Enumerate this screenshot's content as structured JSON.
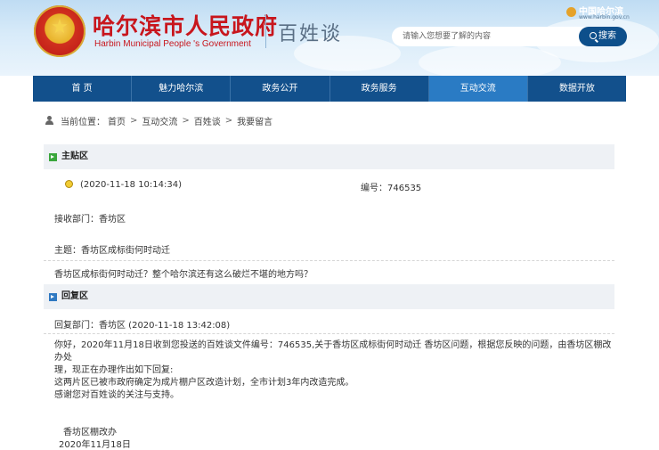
{
  "header": {
    "site_title": "哈尔滨市人民政府",
    "site_subtitle": "Harbin Municipal People 's Government",
    "column_title": "百姓谈",
    "top_link_label": "中国哈尔滨",
    "top_link_url": "www.harbin.gov.cn",
    "search_placeholder": "请输入您想要了解的内容",
    "search_button": "搜索"
  },
  "nav": {
    "items": [
      {
        "label": "首 页"
      },
      {
        "label": "魅力哈尔滨"
      },
      {
        "label": "政务公开"
      },
      {
        "label": "政务服务"
      },
      {
        "label": "互动交流"
      },
      {
        "label": "数据开放"
      }
    ],
    "active_index": 4
  },
  "breadcrumb": {
    "prefix": "当前位置：",
    "items": [
      "首页",
      "互动交流",
      "百姓谈",
      "我要留言"
    ],
    "separator": ">"
  },
  "post": {
    "section_label": "主贴区",
    "datetime": "(2020-11-18 10:14:34)",
    "number_label": "编号：746535",
    "dept": "接收部门：香坊区",
    "subject": "主题：香坊区成标街何时动迁",
    "body": "香坊区成标街何时动迁？整个哈尔滨还有这么破烂不堪的地方吗？"
  },
  "reply": {
    "section_label": "回复区",
    "meta": "回复部门：香坊区 (2020-11-18 13:42:08)",
    "lines": [
      "你好，2020年11月18日收到您投送的百姓谈文件编号：746535,关于香坊区成标街何时动迁 香坊区问题，根据您反映的问题，由香坊区棚改办处",
      "理，现正在办理作出如下回复:",
      "这两片区已被市政府确定为成片棚户区改造计划，全市计划3年内改造完成。",
      "感谢您对百姓谈的关注与支持。"
    ],
    "signature": "香坊区棚改办",
    "date": "2020年11月18日"
  },
  "colors": {
    "nav_bg": "#12508c",
    "nav_active": "#2a7bc4",
    "title_red": "#c8161d",
    "section_bg": "#eef1f5"
  }
}
